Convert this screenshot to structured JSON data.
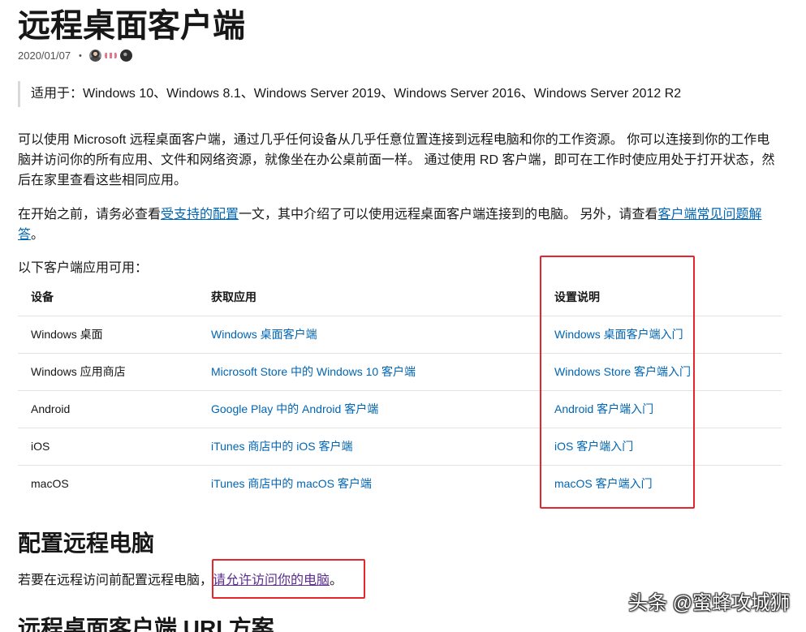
{
  "article": {
    "title": "远程桌面客户端",
    "date": "2020/01/07",
    "separator": "•",
    "contributors": [
      {
        "icon": "contributor-avatar",
        "color": "#8a8a8a"
      },
      {
        "icon": "contributor-avatar",
        "color": "#e0788c"
      },
      {
        "icon": "contributor-avatar",
        "color": "#2e2e2e"
      }
    ]
  },
  "applies_to": "适用于：Windows 10、Windows 8.1、Windows Server 2019、Windows Server 2016、Windows Server 2012 R2",
  "intro": "可以使用 Microsoft 远程桌面客户端，通过几乎任何设备从几乎任意位置连接到远程电脑和你的工作资源。 你可以连接到你的工作电脑并访问你的所有应用、文件和网络资源，就像坐在办公桌前面一样。 通过使用 RD 客户端，即可在工作时使应用处于打开状态，然后在家里查看这些相同应用。",
  "prerequisites": {
    "text_before": "在开始之前，请务必查看",
    "supported_config_link": "受支持的配置",
    "text_middle": "一文，其中介绍了可以使用远程桌面客户端连接到的电脑。 另外，请查看",
    "faq_link": "客户端常见问题解答",
    "text_after": "。"
  },
  "clients": {
    "label": "以下客户端应用可用：",
    "headers": [
      "设备",
      "获取应用",
      "设置说明"
    ],
    "rows": [
      {
        "device": "Windows 桌面",
        "get_app": "Windows 桌面客户端",
        "setup": "Windows 桌面客户端入门"
      },
      {
        "device": "Windows 应用商店",
        "get_app": "Microsoft Store 中的 Windows 10 客户端",
        "setup": "Windows Store 客户端入门"
      },
      {
        "device": "Android",
        "get_app": "Google Play 中的 Android 客户端",
        "setup": "Android 客户端入门"
      },
      {
        "device": "iOS",
        "get_app": "iTunes 商店中的 iOS 客户端",
        "setup": "iOS 客户端入门"
      },
      {
        "device": "macOS",
        "get_app": "iTunes 商店中的 macOS 客户端",
        "setup": "macOS 客户端入门"
      }
    ]
  },
  "configure": {
    "heading": "配置远程电脑",
    "text_before": "若要在远程访问前配置远程电脑，",
    "allow_access_link": "请允许访问你的电脑",
    "text_after": "。"
  },
  "next_section": {
    "heading": "远程桌面客户端 URI 方案"
  },
  "watermark": {
    "text": "头条 @蜜蜂攻城狮"
  },
  "colors": {
    "text": "#171717",
    "muted": "#505050",
    "link": "#0065b3",
    "visited_link": "#5b2d8e",
    "border": "#e3e3e3",
    "annotation": "#e5262b"
  }
}
